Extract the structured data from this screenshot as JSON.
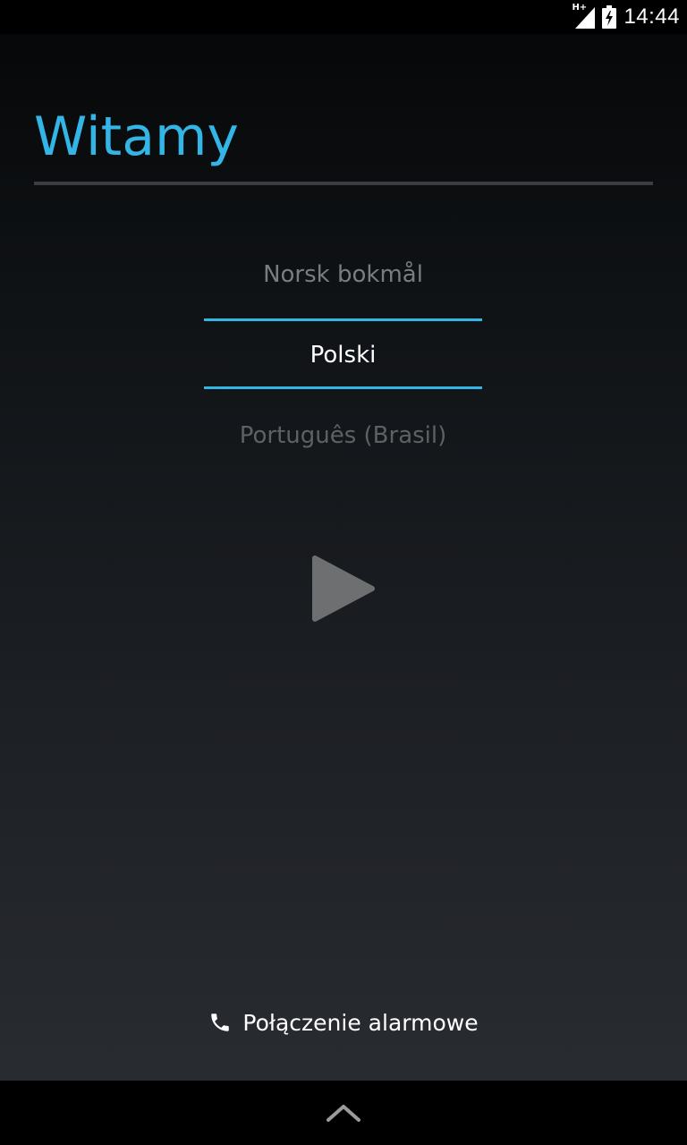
{
  "status_bar": {
    "network_type": "H+",
    "time": "14:44",
    "icons": [
      "signal-icon",
      "battery-charging-icon"
    ]
  },
  "header": {
    "title": "Witamy"
  },
  "language_picker": {
    "previous": "Norsk bokmål",
    "selected": "Polski",
    "next": "Português (Brasil)"
  },
  "start": {
    "icon": "play-icon"
  },
  "emergency": {
    "icon": "phone-icon",
    "label": "Połączenie alarmowe"
  },
  "nav_bar": {
    "icon": "chevron-up-icon"
  },
  "colors": {
    "accent": "#33b5e5",
    "background_top": "#050607",
    "background_bottom": "#2b2e33"
  }
}
